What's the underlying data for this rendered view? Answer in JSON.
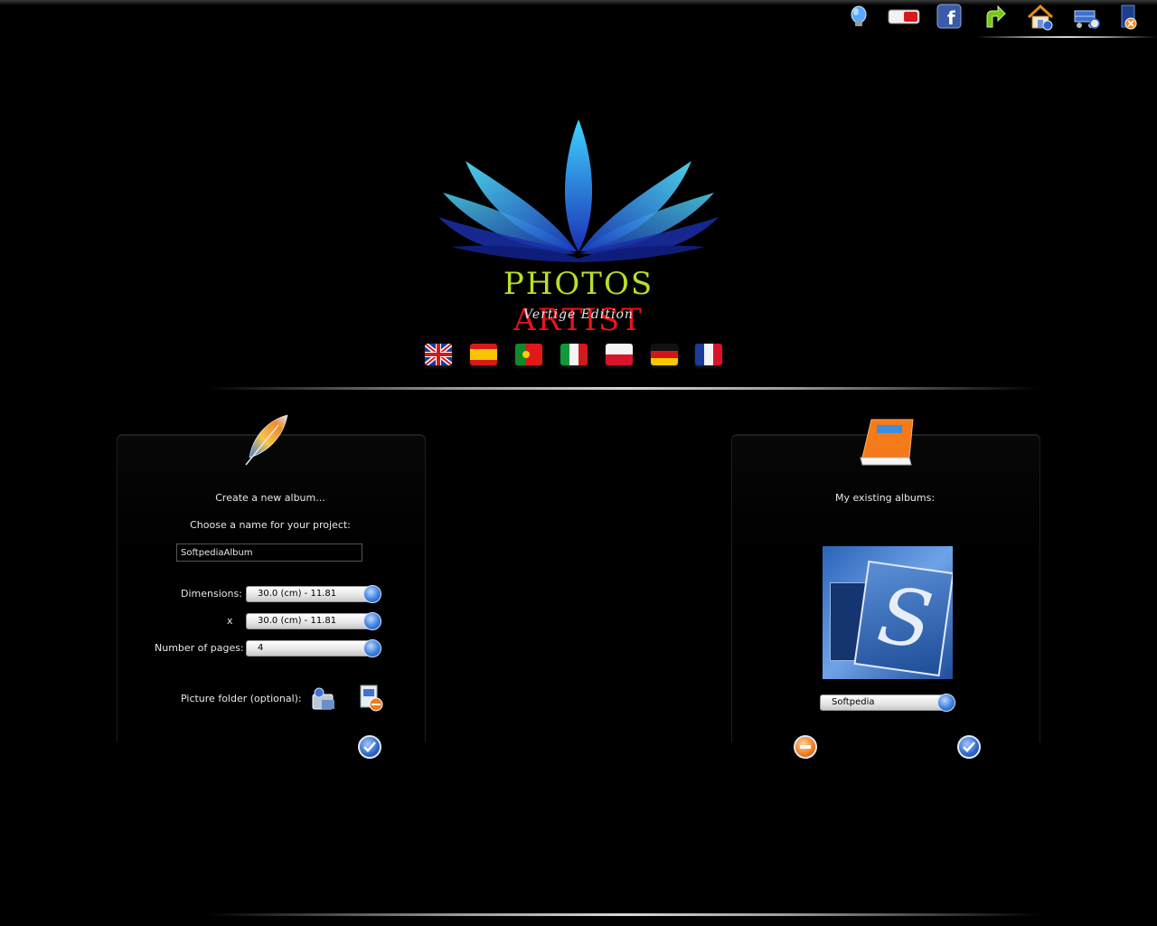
{
  "app": {
    "brand_word1": "PHOTOS",
    "brand_word2": "ARTIST",
    "edition": "Vertige Edition"
  },
  "toolbar": {
    "icons": [
      "lightbulb-icon",
      "youtube-icon",
      "facebook-icon",
      "update-arrow-icon",
      "home-icon",
      "cart-icon",
      "close-icon"
    ],
    "youtube_text": "YouTube",
    "facebook_text": "f"
  },
  "languages": [
    "english-flag-icon",
    "spanish-flag-icon",
    "portuguese-flag-icon",
    "italian-flag-icon",
    "polish-flag-icon",
    "german-flag-icon",
    "french-flag-icon"
  ],
  "new_album": {
    "heading": "Create a new album...",
    "name_prompt": "Choose a name for your project:",
    "name_value": "SoftpediaAlbum",
    "dimensions_label": "Dimensions:",
    "width_value": "30.0  (cm) - 11.81",
    "times_symbol": "x",
    "height_value": "30.0  (cm) - 11.81",
    "pages_label": "Number of pages:",
    "pages_value": "4",
    "folder_label": "Picture folder (optional):"
  },
  "existing_albums": {
    "heading": "My existing albums:",
    "selected_album": "Softpedia",
    "thumbnail_letter": "S"
  },
  "colors": {
    "brand_green": "#b8e02a",
    "brand_red": "#e8141c",
    "accent_blue": "#2d66c9"
  }
}
